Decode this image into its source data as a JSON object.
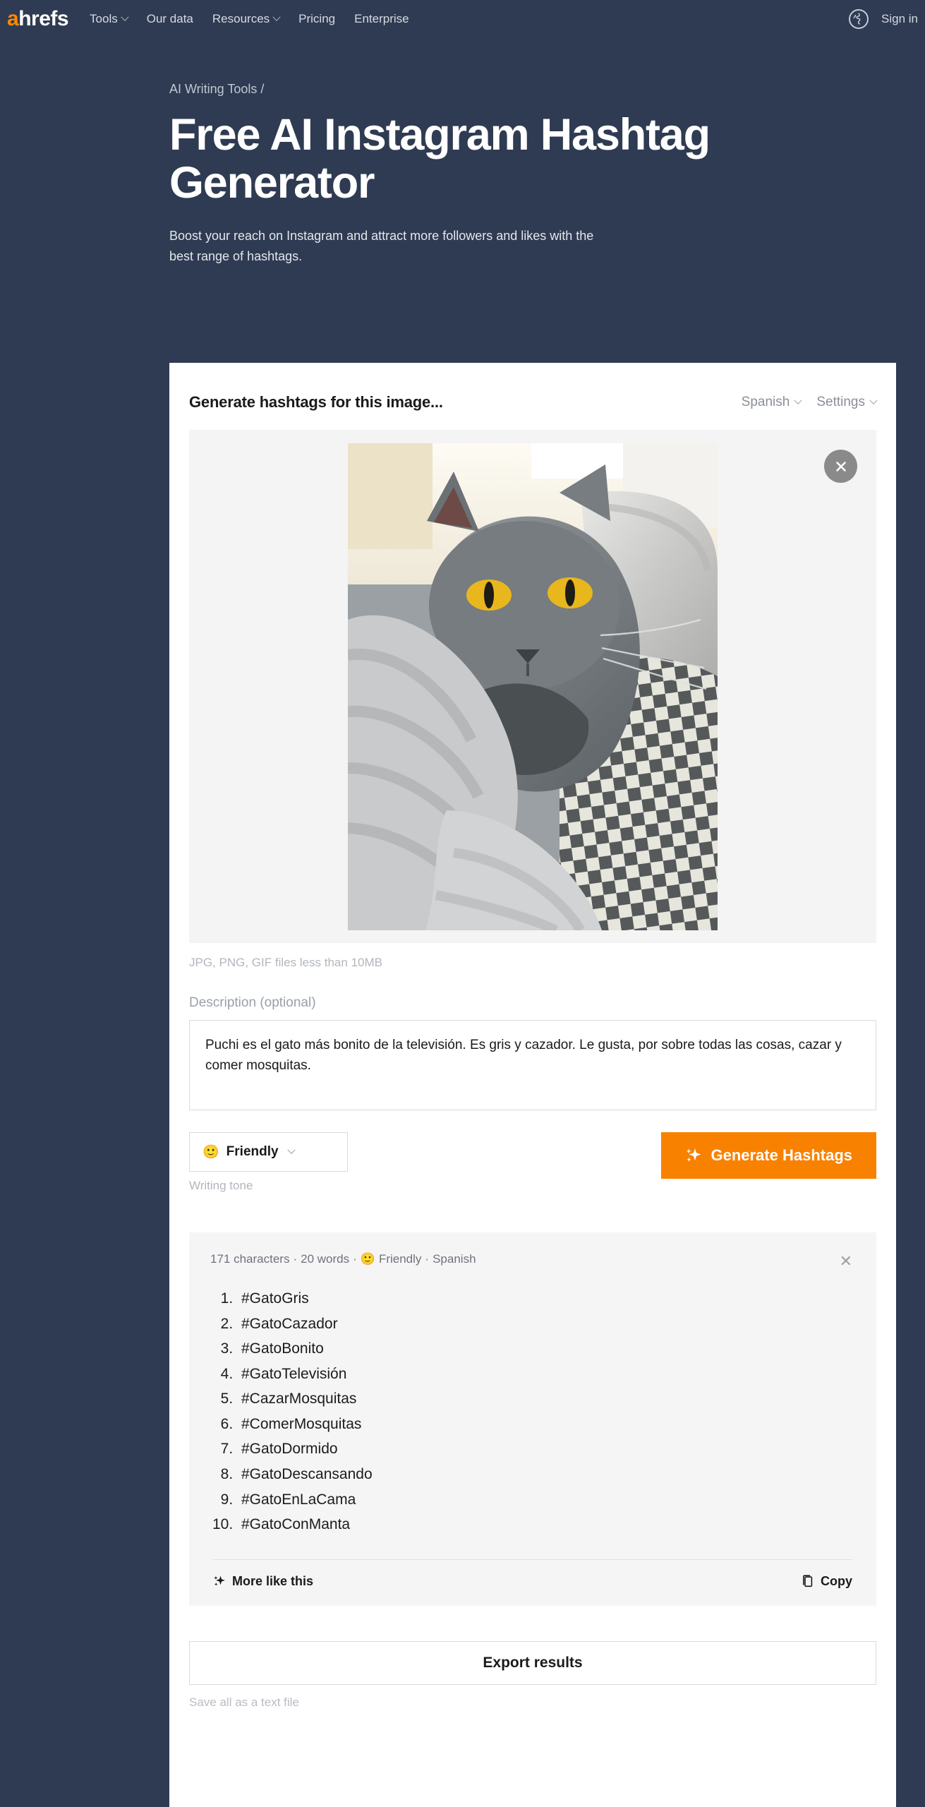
{
  "colors": {
    "page_bg": "#2f3b52",
    "accent_orange": "#f98100",
    "card_bg": "#ffffff",
    "results_bg": "#f5f5f6"
  },
  "nav": {
    "logo_a": "a",
    "logo_rest": "hrefs",
    "items": [
      {
        "label": "Tools",
        "has_caret": true
      },
      {
        "label": "Our data",
        "has_caret": false
      },
      {
        "label": "Resources",
        "has_caret": true
      },
      {
        "label": "Pricing",
        "has_caret": false
      },
      {
        "label": "Enterprise",
        "has_caret": false
      }
    ],
    "signin": "Sign in",
    "globe_icon": "globe-icon"
  },
  "hero": {
    "breadcrumb": "AI Writing Tools /",
    "title": "Free AI Instagram Hashtag Generator",
    "subtitle": "Boost your reach on Instagram and attract more followers and likes with the best range of hashtags."
  },
  "card": {
    "title": "Generate hashtags for this image...",
    "language": "Spanish",
    "settings": "Settings",
    "file_hint": "JPG, PNG, GIF files less than 10MB",
    "close_image_icon": "close-icon",
    "description_label": "Description (optional)",
    "description_value": "Puchi es el gato más bonito de la televisión. Es gris y cazador. Le gusta, por sobre todas las cosas, cazar y comer mosquitas.",
    "description_placeholder": "Description (optional)",
    "tone_emoji": "🙂",
    "tone_value": "Friendly",
    "writing_tone_label": "Writing tone",
    "generate_label": "Generate Hashtags",
    "generate_icon": "sparkle-icon"
  },
  "results": {
    "characters": "171 characters",
    "words": "20 words",
    "tone_emoji": "🙂",
    "tone": "Friendly",
    "language": "Spanish",
    "sep": "·",
    "close_icon": "close-icon",
    "hashtags": [
      "#GatoGris",
      "#GatoCazador",
      "#GatoBonito",
      "#GatoTelevisión",
      "#CazarMosquitas",
      "#ComerMosquitas",
      "#GatoDormido",
      "#GatoDescansando",
      "#GatoEnLaCama",
      "#GatoConManta"
    ],
    "more_like_this": "More like this",
    "more_icon": "sparkle-icon",
    "copy": "Copy",
    "copy_icon": "copy-icon"
  },
  "footer": {
    "export_label": "Export results",
    "export_hint": "Save all as a text file"
  }
}
